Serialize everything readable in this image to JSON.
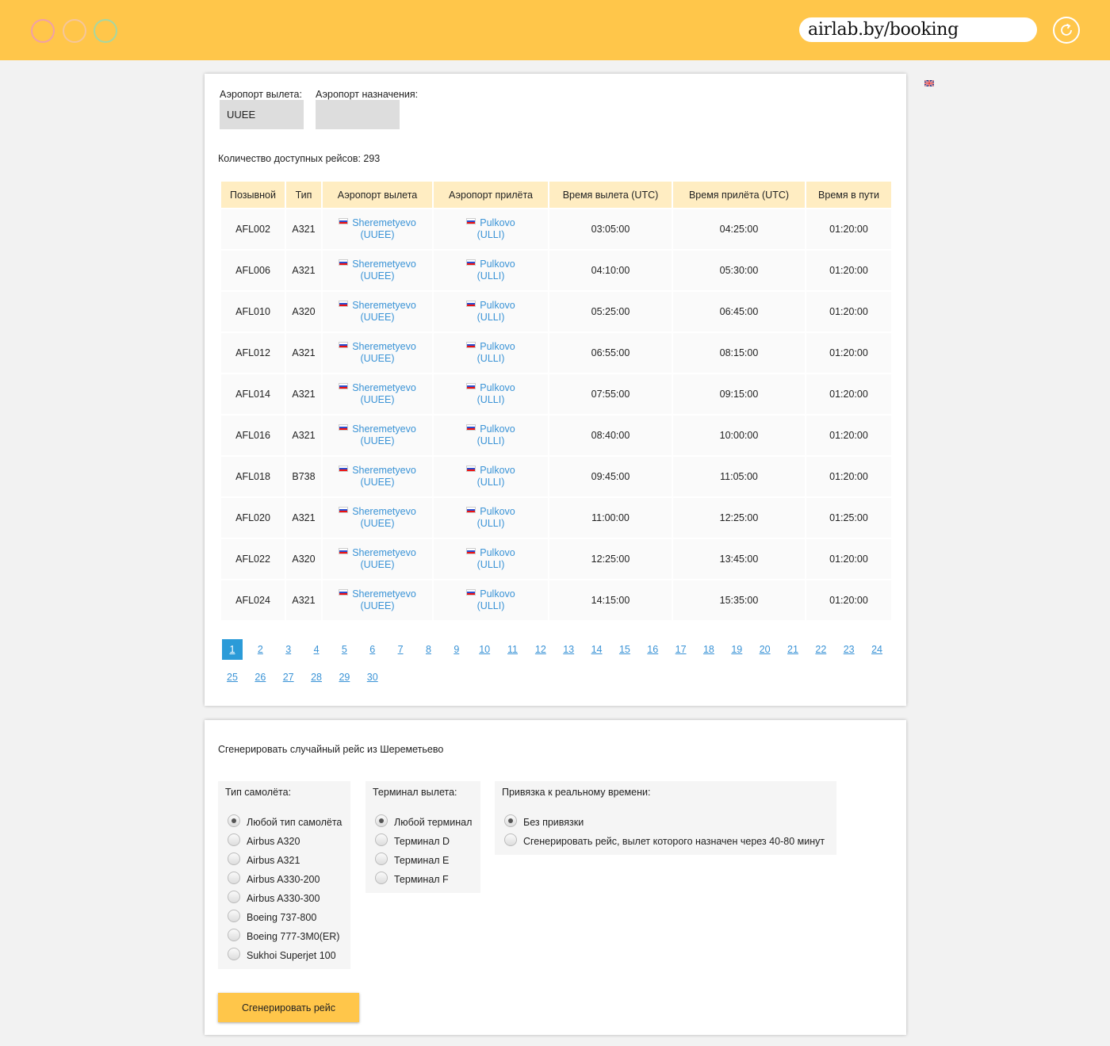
{
  "browser": {
    "url": "airlab.by/booking",
    "dots": [
      "#f0a0a8",
      "#f5c69b",
      "#a6d7a2"
    ]
  },
  "filters": {
    "departure_label": "Аэропорт вылета:",
    "departure_value": "UUEE",
    "arrival_label": "Аэропорт назначения:",
    "arrival_value": ""
  },
  "flight_count": "Количество доступных рейсов: 293",
  "table": {
    "headers": [
      "Позывной",
      "Тип",
      "Аэропорт вылета",
      "Аэропорт прилёта",
      "Время вылета (UTC)",
      "Время прилёта (UTC)",
      "Время в пути"
    ],
    "rows": [
      {
        "callsign": "AFL002",
        "type": "A321",
        "dep_name": "Sheremetyevo",
        "dep_code": "(UUEE)",
        "arr_name": "Pulkovo",
        "arr_code": "(ULLI)",
        "dep_time": "03:05:00",
        "arr_time": "04:25:00",
        "duration": "01:20:00"
      },
      {
        "callsign": "AFL006",
        "type": "A321",
        "dep_name": "Sheremetyevo",
        "dep_code": "(UUEE)",
        "arr_name": "Pulkovo",
        "arr_code": "(ULLI)",
        "dep_time": "04:10:00",
        "arr_time": "05:30:00",
        "duration": "01:20:00"
      },
      {
        "callsign": "AFL010",
        "type": "A320",
        "dep_name": "Sheremetyevo",
        "dep_code": "(UUEE)",
        "arr_name": "Pulkovo",
        "arr_code": "(ULLI)",
        "dep_time": "05:25:00",
        "arr_time": "06:45:00",
        "duration": "01:20:00"
      },
      {
        "callsign": "AFL012",
        "type": "A321",
        "dep_name": "Sheremetyevo",
        "dep_code": "(UUEE)",
        "arr_name": "Pulkovo",
        "arr_code": "(ULLI)",
        "dep_time": "06:55:00",
        "arr_time": "08:15:00",
        "duration": "01:20:00"
      },
      {
        "callsign": "AFL014",
        "type": "A321",
        "dep_name": "Sheremetyevo",
        "dep_code": "(UUEE)",
        "arr_name": "Pulkovo",
        "arr_code": "(ULLI)",
        "dep_time": "07:55:00",
        "arr_time": "09:15:00",
        "duration": "01:20:00"
      },
      {
        "callsign": "AFL016",
        "type": "A321",
        "dep_name": "Sheremetyevo",
        "dep_code": "(UUEE)",
        "arr_name": "Pulkovo",
        "arr_code": "(ULLI)",
        "dep_time": "08:40:00",
        "arr_time": "10:00:00",
        "duration": "01:20:00"
      },
      {
        "callsign": "AFL018",
        "type": "B738",
        "dep_name": "Sheremetyevo",
        "dep_code": "(UUEE)",
        "arr_name": "Pulkovo",
        "arr_code": "(ULLI)",
        "dep_time": "09:45:00",
        "arr_time": "11:05:00",
        "duration": "01:20:00"
      },
      {
        "callsign": "AFL020",
        "type": "A321",
        "dep_name": "Sheremetyevo",
        "dep_code": "(UUEE)",
        "arr_name": "Pulkovo",
        "arr_code": "(ULLI)",
        "dep_time": "11:00:00",
        "arr_time": "12:25:00",
        "duration": "01:25:00"
      },
      {
        "callsign": "AFL022",
        "type": "A320",
        "dep_name": "Sheremetyevo",
        "dep_code": "(UUEE)",
        "arr_name": "Pulkovo",
        "arr_code": "(ULLI)",
        "dep_time": "12:25:00",
        "arr_time": "13:45:00",
        "duration": "01:20:00"
      },
      {
        "callsign": "AFL024",
        "type": "A321",
        "dep_name": "Sheremetyevo",
        "dep_code": "(UUEE)",
        "arr_name": "Pulkovo",
        "arr_code": "(ULLI)",
        "dep_time": "14:15:00",
        "arr_time": "15:35:00",
        "duration": "01:20:00"
      }
    ]
  },
  "pagination": {
    "current": "1",
    "pages": [
      "1",
      "2",
      "3",
      "4",
      "5",
      "6",
      "7",
      "8",
      "9",
      "10",
      "11",
      "12",
      "13",
      "14",
      "15",
      "16",
      "17",
      "18",
      "19",
      "20",
      "21",
      "22",
      "23",
      "24",
      "25",
      "26",
      "27",
      "28",
      "29",
      "30"
    ]
  },
  "generator": {
    "title": "Сгенерировать случайный рейс из Шереметьево",
    "aircraft": {
      "title": "Тип самолёта:",
      "options": [
        "Любой тип самолёта",
        "Airbus A320",
        "Airbus A321",
        "Airbus A330-200",
        "Airbus A330-300",
        "Boeing 737-800",
        "Boeing 777-3M0(ER)",
        "Sukhoi Superjet 100"
      ],
      "selected": "Любой тип самолёта"
    },
    "terminal": {
      "title": "Терминал вылета:",
      "options": [
        "Любой терминал",
        "Терминал D",
        "Терминал E",
        "Терминал F"
      ],
      "selected": "Любой терминал"
    },
    "timing": {
      "title": "Привязка к реальному времени:",
      "options": [
        "Без привязки",
        "Сгенерировать рейс, вылет которого назначен через 40-80 минут"
      ],
      "selected": "Без привязки"
    },
    "button_label": "Сгенерировать рейс"
  },
  "icons": {
    "reload": "reload-icon",
    "language": "uk-flag-icon",
    "airport_flag": "russia-flag-icon"
  },
  "colors": {
    "accent": "#ffc64a",
    "link": "#3a93d6",
    "active_page": "#2b9bd8",
    "table_header": "#ffedc2"
  }
}
